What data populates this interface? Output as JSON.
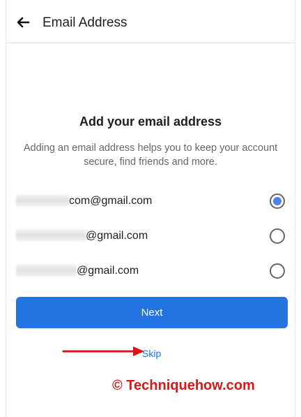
{
  "header": {
    "title": "Email Address",
    "back_icon": "arrow-left-icon"
  },
  "main": {
    "heading": "Add your email address",
    "description": "Adding an email address helps you to keep your account secure, find friends and more."
  },
  "email_options": [
    {
      "visible_suffix": "com@gmail.com",
      "selected": true
    },
    {
      "visible_suffix": "@gmail.com",
      "selected": false
    },
    {
      "visible_suffix": "@gmail.com",
      "selected": false
    }
  ],
  "actions": {
    "next_label": "Next",
    "skip_label": "Skip"
  },
  "annotation": {
    "arrow_color": "#e01414"
  },
  "watermark": {
    "text": "© Techniquehow.com",
    "color": "#d21a1a"
  },
  "colors": {
    "primary": "#2374e1",
    "link": "#1b74e4",
    "radio_selected": "#4f83ea"
  }
}
